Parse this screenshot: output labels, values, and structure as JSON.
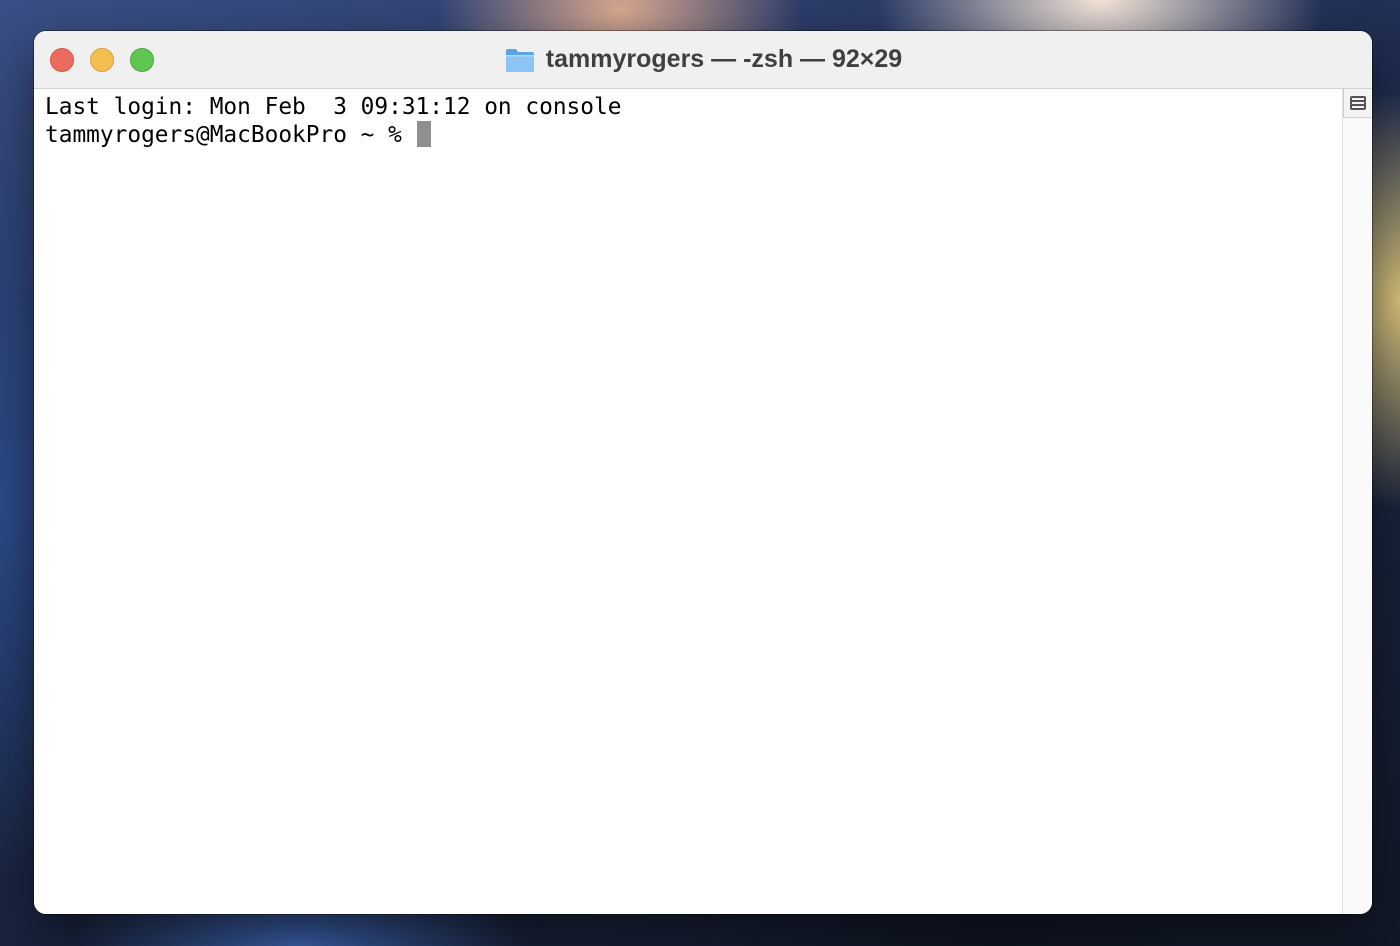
{
  "window": {
    "title": "tammyrogers — -zsh — 92×29",
    "title_icon": "folder-icon",
    "controls": {
      "close": "close-button",
      "minimize": "minimize-button",
      "zoom": "zoom-button"
    },
    "colors": {
      "close": "#ec6a5e",
      "minimize": "#f4bf4f",
      "zoom": "#61c554",
      "cursor": "#8f8f8f"
    }
  },
  "terminal": {
    "lines": [
      "Last login: Mon Feb  3 09:31:12 on console",
      "tammyrogers@MacBookPro ~ % "
    ]
  },
  "scrollbar": {
    "split_icon": "split-pane-icon"
  }
}
